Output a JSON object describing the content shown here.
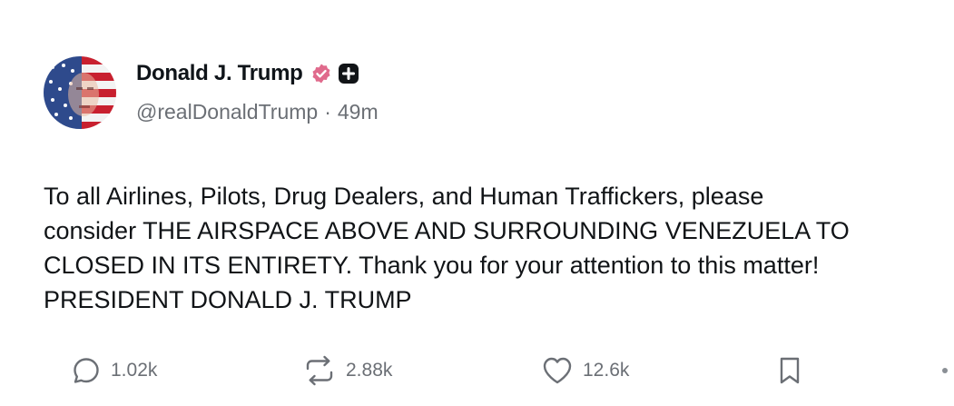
{
  "author": {
    "display_name": "Donald J. Trump",
    "handle": "@realDonaldTrump",
    "separator": "·",
    "time_ago": "49m"
  },
  "icons": {
    "verified": "verified-badge-icon",
    "plus": "plus-badge-icon",
    "reply": "reply-icon",
    "retruth": "retruth-icon",
    "like": "heart-icon",
    "bookmark": "bookmark-icon",
    "more": "more-icon"
  },
  "post": {
    "lines": [
      "To all Airlines, Pilots, Drug Dealers, and Human Traffickers, please",
      "consider THE AIRSPACE ABOVE AND SURROUNDING VENEZUELA TO",
      "CLOSED IN ITS ENTIRETY. Thank you for your attention to this matter!",
      "PRESIDENT DONALD J. TRUMP"
    ]
  },
  "actions": {
    "replies": "1.02k",
    "retruths": "2.88k",
    "likes": "12.6k"
  },
  "colors": {
    "verified_badge": "#e06a8c",
    "text": "#0f1419",
    "muted": "#6b6f75"
  }
}
